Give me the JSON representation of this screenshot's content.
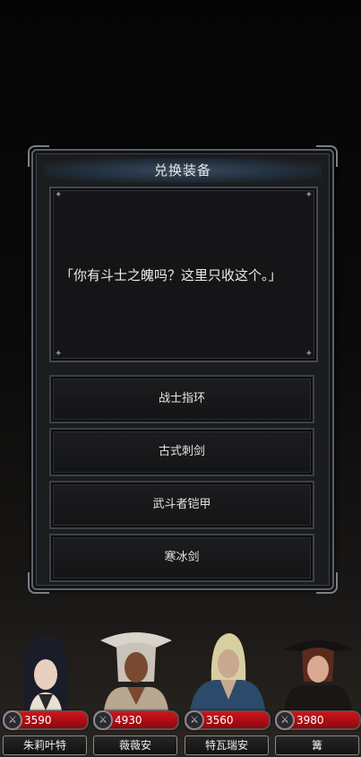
{
  "dialog": {
    "title": "兑换装备",
    "message": "「你有斗士之魄吗？这里只收这个。」",
    "options": [
      "战士指环",
      "古式刺剑",
      "武斗者铠甲",
      "寒冰剑"
    ]
  },
  "party": [
    {
      "name": "朱莉叶特",
      "hp": "3590",
      "colors": {
        "hair": "#1a1c28",
        "skin": "#e8d0c0",
        "garb": "#e8e0d0"
      }
    },
    {
      "name": "薇薇安",
      "hp": "4930",
      "colors": {
        "hair": "#d8d4cc",
        "skin": "#7a4a30",
        "garb": "#b8a890"
      }
    },
    {
      "name": "特瓦瑞安",
      "hp": "3560",
      "colors": {
        "hair": "#d8cfa0",
        "skin": "#c8a890",
        "garb": "#2c4a6a"
      }
    },
    {
      "name": "篝",
      "hp": "3980",
      "colors": {
        "hair": "#5a2a1e",
        "skin": "#d8a890",
        "garb": "#1a1614"
      }
    }
  ],
  "icons": {
    "hp": "sword-emblem-icon",
    "corner": "sparkle-icon"
  }
}
